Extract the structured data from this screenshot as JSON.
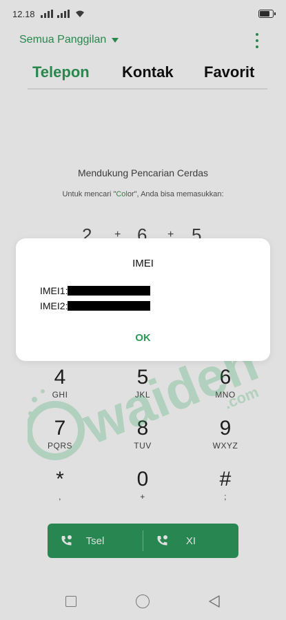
{
  "status": {
    "time": "12.18",
    "battery_level": 0.85
  },
  "header": {
    "filter_label": "Semua Panggilan",
    "more_icon": "more-vert-icon"
  },
  "tabs": [
    {
      "label": "Telepon",
      "active": true
    },
    {
      "label": "Kontak",
      "active": false
    },
    {
      "label": "Favorit",
      "active": false
    }
  ],
  "smart_search": {
    "title": "Mendukung Pencarian Cerdas",
    "subtitle_prefix": "Untuk mencari \"",
    "subtitle_highlight": "Col",
    "subtitle_mid": "or",
    "subtitle_suffix": "\", Anda bisa memasukkan:",
    "hint_digits": [
      "2",
      "+",
      "6",
      "+",
      "5"
    ]
  },
  "dialpad": [
    {
      "digit": "4",
      "letters": "GHI"
    },
    {
      "digit": "5",
      "letters": "JKL"
    },
    {
      "digit": "6",
      "letters": "MNO"
    },
    {
      "digit": "7",
      "letters": "PQRS"
    },
    {
      "digit": "8",
      "letters": "TUV"
    },
    {
      "digit": "9",
      "letters": "WXYZ"
    },
    {
      "digit": "*",
      "letters": ","
    },
    {
      "digit": "0",
      "letters": "+"
    },
    {
      "digit": "#",
      "letters": ";"
    }
  ],
  "call_bar": {
    "sim1_label": "Tsel",
    "sim2_label": "XI",
    "accent": "#2e9a5c"
  },
  "dialog": {
    "title": "IMEI",
    "imei1_label": "IMEI1:",
    "imei2_label": "IMEI2:",
    "ok_label": "OK"
  },
  "watermark": {
    "text": "waiden",
    "suffix": ".com"
  },
  "colors": {
    "accent": "#2d9a57"
  }
}
